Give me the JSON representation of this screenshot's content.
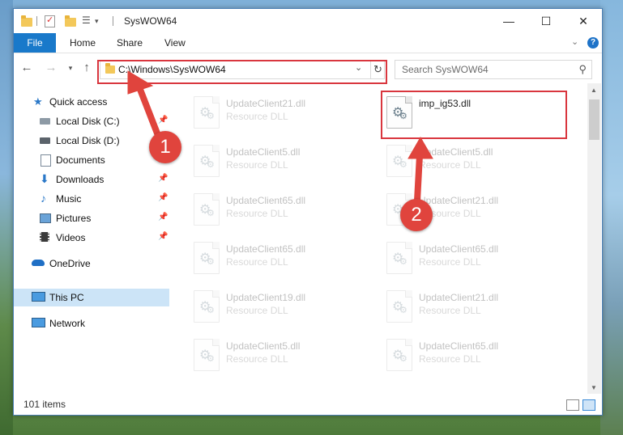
{
  "window": {
    "title": "SysWOW64",
    "controls": {
      "minimize": "—",
      "maximize": "☐",
      "close": "✕"
    }
  },
  "ribbon": {
    "file": "File",
    "tabs": [
      "Home",
      "Share",
      "View"
    ],
    "help": "?"
  },
  "address": {
    "path": "C:\\Windows\\SysWOW64"
  },
  "search": {
    "placeholder": "Search SysWOW64"
  },
  "sidebar": {
    "items": [
      {
        "label": "Quick access",
        "icon": "star-icon",
        "pinned": false
      },
      {
        "label": "Local Disk (C:)",
        "icon": "drive-icon",
        "pinned": true
      },
      {
        "label": "Local Disk (D:)",
        "icon": "drive-icon",
        "pinned": false
      },
      {
        "label": "Documents",
        "icon": "documents-icon",
        "pinned": true
      },
      {
        "label": "Downloads",
        "icon": "download-arrow-icon",
        "pinned": true
      },
      {
        "label": "Music",
        "icon": "music-note-icon",
        "pinned": true
      },
      {
        "label": "Pictures",
        "icon": "pictures-icon",
        "pinned": true
      },
      {
        "label": "Videos",
        "icon": "film-icon",
        "pinned": true
      },
      {
        "label": "OneDrive",
        "icon": "cloud-icon",
        "pinned": false
      },
      {
        "label": "This PC",
        "icon": "monitor-icon",
        "pinned": false,
        "selected": true
      },
      {
        "label": "Network",
        "icon": "network-icon",
        "pinned": false
      }
    ]
  },
  "files": {
    "highlighted": {
      "name": "imp_ig53.dll"
    },
    "left": [
      {
        "name": "UpdateClient21.dll",
        "type": "Resource DLL"
      },
      {
        "name": "UpdateClient5.dll",
        "type": "Resource DLL"
      },
      {
        "name": "UpdateClient65.dll",
        "type": "Resource DLL"
      },
      {
        "name": "UpdateClient65.dll",
        "type": "Resource DLL"
      },
      {
        "name": "UpdateClient19.dll",
        "type": "Resource DLL"
      },
      {
        "name": "UpdateClient5.dll",
        "type": "Resource DLL"
      }
    ],
    "right": [
      {
        "name": "UpdateClient5.dll",
        "type": "Resource DLL"
      },
      {
        "name": "UpdateClient21.dll",
        "type": "Resource DLL"
      },
      {
        "name": "UpdateClient65.dll",
        "type": "Resource DLL"
      },
      {
        "name": "UpdateClient21.dll",
        "type": "Resource DLL"
      },
      {
        "name": "UpdateClient65.dll",
        "type": "Resource DLL"
      }
    ]
  },
  "status": {
    "count": "101 items"
  },
  "callouts": {
    "one": "1",
    "two": "2"
  },
  "colors": {
    "accent": "#1979ca",
    "highlight": "#d9363e",
    "callout": "#e0443d",
    "selected": "#cce4f7"
  }
}
